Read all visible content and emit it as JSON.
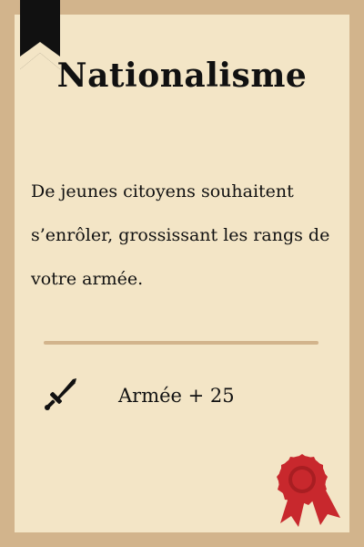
{
  "card": {
    "title": "Nationalisme",
    "description": "De jeunes citoyens souhaitent s’enrôler, grossissant les rangs de votre armée.",
    "effect": {
      "icon": "sword-icon",
      "text": "Armée + 25"
    },
    "decorations": {
      "bookmark": "bookmark-ribbon-icon",
      "seal": "wax-seal-icon"
    }
  },
  "colors": {
    "frame": "#d2b48c",
    "parchment": "#f3e5c6",
    "ink": "#111111",
    "seal_red": "#c8282d"
  }
}
